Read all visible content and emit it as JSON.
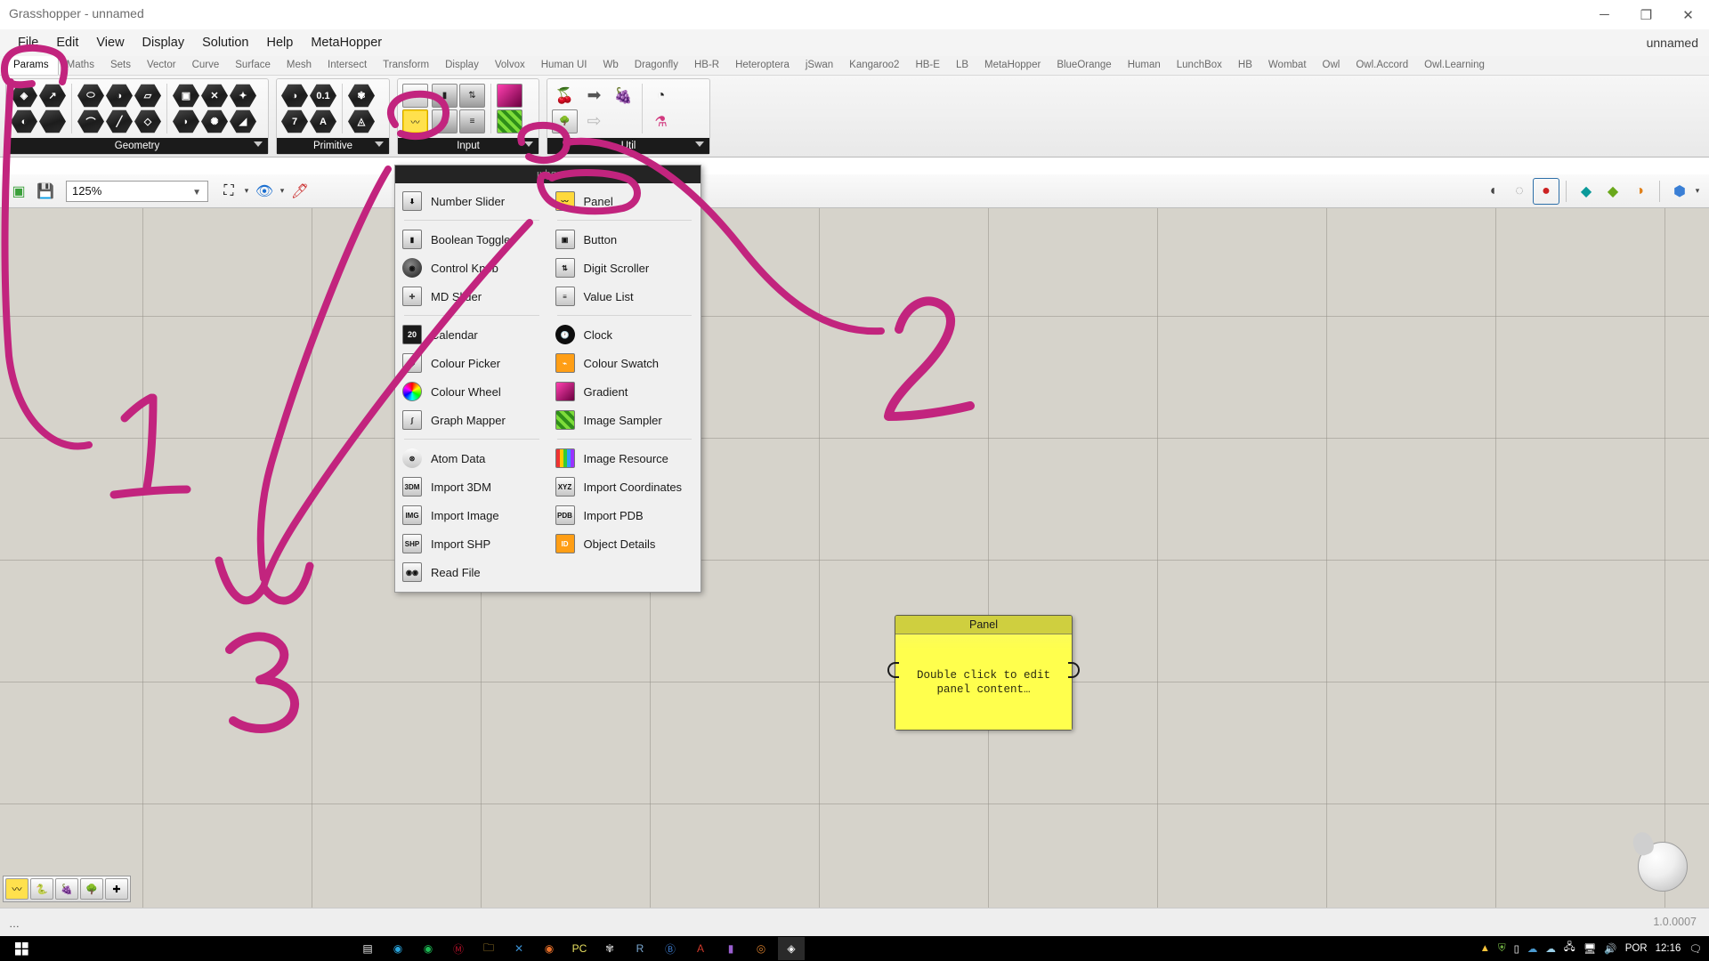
{
  "window": {
    "title": "Grasshopper - unnamed",
    "minimize": "─",
    "maximize": "❐",
    "close": "✕"
  },
  "menubar": {
    "items": [
      "File",
      "Edit",
      "View",
      "Display",
      "Solution",
      "Help",
      "MetaHopper"
    ],
    "right_label": "unnamed"
  },
  "tabs": [
    {
      "label": "Params",
      "active": true
    },
    {
      "label": "Maths",
      "active": false
    },
    {
      "label": "Sets",
      "active": false
    },
    {
      "label": "Vector",
      "active": false
    },
    {
      "label": "Curve",
      "active": false
    },
    {
      "label": "Surface",
      "active": false
    },
    {
      "label": "Mesh",
      "active": false
    },
    {
      "label": "Intersect",
      "active": false
    },
    {
      "label": "Transform",
      "active": false
    },
    {
      "label": "Display",
      "active": false
    },
    {
      "label": "Volvox",
      "active": false
    },
    {
      "label": "Human UI",
      "active": false
    },
    {
      "label": "Wb",
      "active": false
    },
    {
      "label": "Dragonfly",
      "active": false
    },
    {
      "label": "HB-R",
      "active": false
    },
    {
      "label": "Heteroptera",
      "active": false
    },
    {
      "label": "jSwan",
      "active": false
    },
    {
      "label": "Kangaroo2",
      "active": false
    },
    {
      "label": "HB-E",
      "active": false
    },
    {
      "label": "LB",
      "active": false
    },
    {
      "label": "MetaHopper",
      "active": false
    },
    {
      "label": "BlueOrange",
      "active": false
    },
    {
      "label": "Human",
      "active": false
    },
    {
      "label": "LunchBox",
      "active": false
    },
    {
      "label": "HB",
      "active": false
    },
    {
      "label": "Wombat",
      "active": false
    },
    {
      "label": "Owl",
      "active": false
    },
    {
      "label": "Owl.Accord",
      "active": false
    },
    {
      "label": "Owl.Learning",
      "active": false
    }
  ],
  "ribbon": {
    "groups": [
      {
        "name": "Geometry",
        "label": "Geometry"
      },
      {
        "name": "Primitive",
        "label": "Primitive"
      },
      {
        "name": "Input",
        "label": "Input"
      },
      {
        "name": "Util",
        "label": "Util"
      }
    ]
  },
  "toolbar": {
    "zoom_value": "125%",
    "new_label": "new-document",
    "save_label": "save-document"
  },
  "dropdown": {
    "header": "Input",
    "header_mirror": "Input",
    "left_column": [
      {
        "label": "Number Slider",
        "icon": "number-slider-icon"
      },
      {
        "label": "Boolean Toggle",
        "icon": "boolean-toggle-icon"
      },
      {
        "label": "Control Knob",
        "icon": "control-knob-icon"
      },
      {
        "label": "MD Slider",
        "icon": "md-slider-icon"
      },
      {
        "label": "Calendar",
        "icon": "calendar-icon"
      },
      {
        "label": "Colour Picker",
        "icon": "colour-picker-icon"
      },
      {
        "label": "Colour Wheel",
        "icon": "colour-wheel-icon"
      },
      {
        "label": "Graph Mapper",
        "icon": "graph-mapper-icon"
      },
      {
        "label": "Atom Data",
        "icon": "atom-data-icon"
      },
      {
        "label": "Import 3DM",
        "icon": "import-3dm-icon"
      },
      {
        "label": "Import Image",
        "icon": "import-image-icon"
      },
      {
        "label": "Import SHP",
        "icon": "import-shp-icon"
      },
      {
        "label": "Read File",
        "icon": "read-file-icon"
      }
    ],
    "right_column": [
      {
        "label": "Panel",
        "icon": "panel-icon"
      },
      {
        "label": "Button",
        "icon": "button-icon"
      },
      {
        "label": "Digit Scroller",
        "icon": "digit-scroller-icon"
      },
      {
        "label": "Value List",
        "icon": "value-list-icon"
      },
      {
        "label": "Clock",
        "icon": "clock-icon"
      },
      {
        "label": "Colour Swatch",
        "icon": "colour-swatch-icon"
      },
      {
        "label": "Gradient",
        "icon": "gradient-icon"
      },
      {
        "label": "Image Sampler",
        "icon": "image-sampler-icon"
      },
      {
        "label": "Image Resource",
        "icon": "image-resource-icon"
      },
      {
        "label": "Import Coordinates",
        "icon": "import-coordinates-icon"
      },
      {
        "label": "Import PDB",
        "icon": "import-pdb-icon"
      },
      {
        "label": "Object Details",
        "icon": "object-details-icon"
      }
    ]
  },
  "canvas": {
    "panel_component": {
      "title": "Panel",
      "content_line1": "Double click to edit",
      "content_line2": "panel content…"
    }
  },
  "annotations": {
    "marker_color": "#c2247e",
    "numbers": [
      "1",
      "2",
      "3"
    ],
    "note": "Hand-drawn pink marker highlighting Params tab, Input group expander, and Panel entry"
  },
  "statusbar": {
    "left_text": "…",
    "version": "1.0.0007"
  },
  "taskbar": {
    "clock": "12:16",
    "language": "POR",
    "start_icon": "windows-start-icon"
  }
}
